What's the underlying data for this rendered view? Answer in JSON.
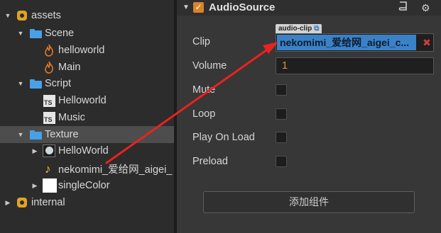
{
  "tree": {
    "assets": "assets",
    "scene": "Scene",
    "helloworld_scene": "helloworld",
    "main_scene": "Main",
    "script": "Script",
    "helloworld_ts": "Helloworld",
    "music_ts": "Music",
    "texture": "Texture",
    "helloworld_tex": "HelloWorld",
    "audio_file": "nekomimi_爱给网_aigei_",
    "singlecolor": "singleColor",
    "internal": "internal",
    "ts_badge": "TS"
  },
  "inspector": {
    "component_title": "AudioSource",
    "clip_label": "Clip",
    "clip_type_tag": "audio-clip",
    "clip_value": "nekomimi_爱给网_aigei_c...",
    "volume_label": "Volume",
    "volume_value": "1",
    "mute_label": "Mute",
    "loop_label": "Loop",
    "play_on_load_label": "Play On Load",
    "preload_label": "Preload",
    "add_component_button": "添加组件"
  },
  "icons": {
    "folder": "folder-icon",
    "scene": "fire-icon",
    "script": "ts-icon",
    "audio": "music-note-icon",
    "book": "book-icon",
    "gear": "gear-icon",
    "remove": "close-icon",
    "link": "external-link-icon"
  },
  "colors": {
    "accent_orange": "#d8842a",
    "clip_blue": "#3a82c8",
    "folder_blue": "#4aa0e6",
    "arrow_red": "#e8231d",
    "remove_red": "#d33b3b"
  }
}
